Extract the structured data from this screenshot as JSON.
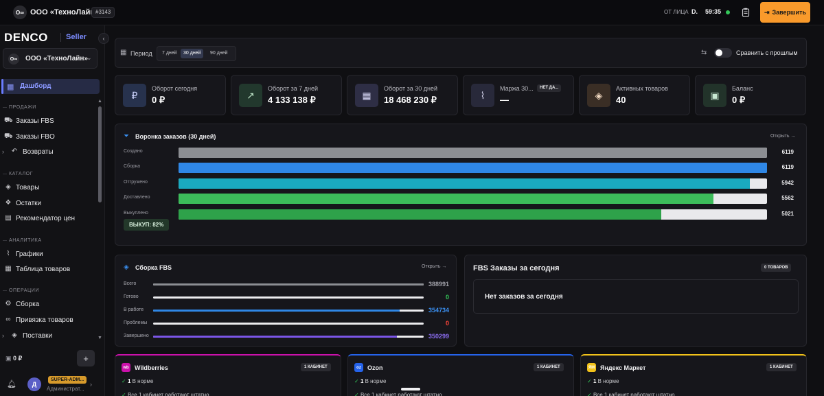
{
  "topbar": {
    "org_logo": "О∞",
    "org_title": "ООО «ТехноЛайн»",
    "org_id": "#3143",
    "proxy_label": "ОТ ЛИЦА",
    "proxy_user": "D.",
    "timer": "59:35",
    "finish_label": "Завершить"
  },
  "sidebar": {
    "brand": "DENCO",
    "brand_sub": "Seller",
    "collapse": "‹",
    "org_logo": "О∞",
    "org_name": "ООО «ТехноЛайн»",
    "active_item": "Дашборд",
    "sections": {
      "sales": "ПРОДАЖИ",
      "catalog": "КАТАЛОГ",
      "analytics": "АНАЛИТИКА",
      "operations": "ОПЕРАЦИИ"
    },
    "items": {
      "fbs_orders": "Заказы FBS",
      "fbo_orders": "Заказы FBO",
      "returns": "Возвраты",
      "products": "Товары",
      "stock": "Остатки",
      "price_recommender": "Рекомендатор цен",
      "charts": "Графики",
      "products_table": "Таблица товаров",
      "assembly": "Сборка",
      "product_binding": "Привязка товаров",
      "supplies": "Поставки"
    },
    "balance": "0 ₽",
    "plus": "+",
    "user_initial": "Д",
    "user_role": "SUPER-ADM...",
    "user_sub": "Администрат..."
  },
  "period": {
    "label": "Период",
    "options": [
      "7 дней",
      "30 дней",
      "90 дней"
    ],
    "selected": "30 дней",
    "compare_label": "Сравнить с прошлым",
    "compare_on": false
  },
  "kpis": [
    {
      "label": "Оборот сегодня",
      "value": "0 ₽",
      "icon": "₽",
      "icon_name": "ruble-icon",
      "icon_bg": "#27324d",
      "icon_color": "#cfd6ff",
      "tag": ""
    },
    {
      "label": "Оборот за 7 дней",
      "value": "4 133 138 ₽",
      "icon": "↗",
      "icon_name": "trend-up-icon",
      "icon_bg": "#22382d",
      "icon_color": "#bfe6c9",
      "tag": ""
    },
    {
      "label": "Оборот за 30 дней",
      "value": "18 468 230 ₽",
      "icon": "▦",
      "icon_name": "calendar-icon",
      "icon_bg": "#2e2e45",
      "icon_color": "#d2d2f0",
      "tag": ""
    },
    {
      "label": "Маржа 30...",
      "value": "—",
      "icon": "⌇",
      "icon_name": "chart-line-icon",
      "icon_bg": "#28293a",
      "icon_color": "#d0d0e8",
      "tag": "НЕТ ДА..."
    },
    {
      "label": "Активных товаров",
      "value": "40",
      "icon": "◈",
      "icon_name": "box-icon",
      "icon_bg": "#3a2e25",
      "icon_color": "#f0d8c0",
      "tag": ""
    },
    {
      "label": "Баланс",
      "value": "0 ₽",
      "icon": "▣",
      "icon_name": "wallet-icon",
      "icon_bg": "#22332a",
      "icon_color": "#c8e8d2",
      "tag": ""
    }
  ],
  "funnel": {
    "title": "Воронка заказов (30 дней)",
    "open_link": "Открыть →",
    "max": 6119,
    "rows": [
      {
        "label": "Создано",
        "value": 6119,
        "color": "#8c8e93"
      },
      {
        "label": "Сборка",
        "value": 6119,
        "color": "#2f87e6"
      },
      {
        "label": "Отгружено",
        "value": 5942,
        "color": "#1aaac0"
      },
      {
        "label": "Доставлено",
        "value": 5562,
        "color": "#3cbc5a"
      },
      {
        "label": "Выкуплено",
        "value": 5021,
        "color": "#2ea24a"
      }
    ],
    "buyout": "ВЫКУП: 82%"
  },
  "fbs_assembly": {
    "title": "Сборка FBS",
    "open_link": "Открыть →",
    "total": 388991,
    "rows": [
      {
        "label": "Всего",
        "value": "388991",
        "num": 388991,
        "color": "#8c8e93",
        "num_color": "#a0a0a8"
      },
      {
        "label": "Готово",
        "value": "0",
        "num": 0,
        "color": "#34c759",
        "num_color": "#34c759"
      },
      {
        "label": "В работе",
        "value": "354734",
        "num": 354734,
        "color": "#2f87e6",
        "num_color": "#3a8ff0"
      },
      {
        "label": "Проблемы",
        "value": "0",
        "num": 0,
        "color": "#ff453a",
        "num_color": "#ff453a"
      },
      {
        "label": "Завершено",
        "value": "350299",
        "num": 350299,
        "color": "#7b55e8",
        "num_color": "#8b6cf0"
      }
    ]
  },
  "fbs_today": {
    "title": "FBS Заказы за сегодня",
    "badge": "0 ТОВАРОВ",
    "empty": "Нет заказов за сегодня"
  },
  "marketplaces": [
    {
      "name": "Wildberries",
      "logo": "wb",
      "logo_name": "wildberries-logo-icon",
      "accent": "#cb11ab",
      "cabinets": "1 КАБИНЕТ",
      "ok_count": "1",
      "ok_text": "В норме",
      "all_text": "Все 1 кабинет работают штатно"
    },
    {
      "name": "Ozon",
      "logo": "oz",
      "logo_name": "ozon-logo-icon",
      "accent": "#2563eb",
      "cabinets": "1 КАБИНЕТ",
      "ok_count": "1",
      "ok_text": "В норме",
      "all_text": "Все 1 кабинет работают штатно"
    },
    {
      "name": "Яндекс Маркет",
      "logo": "ЯМ",
      "logo_name": "yandex-market-logo-icon",
      "accent": "#f2c21a",
      "cabinets": "1 КАБИНЕТ",
      "ok_count": "1",
      "ok_text": "В норме",
      "all_text": "Все 1 кабинет работают штатно"
    }
  ]
}
